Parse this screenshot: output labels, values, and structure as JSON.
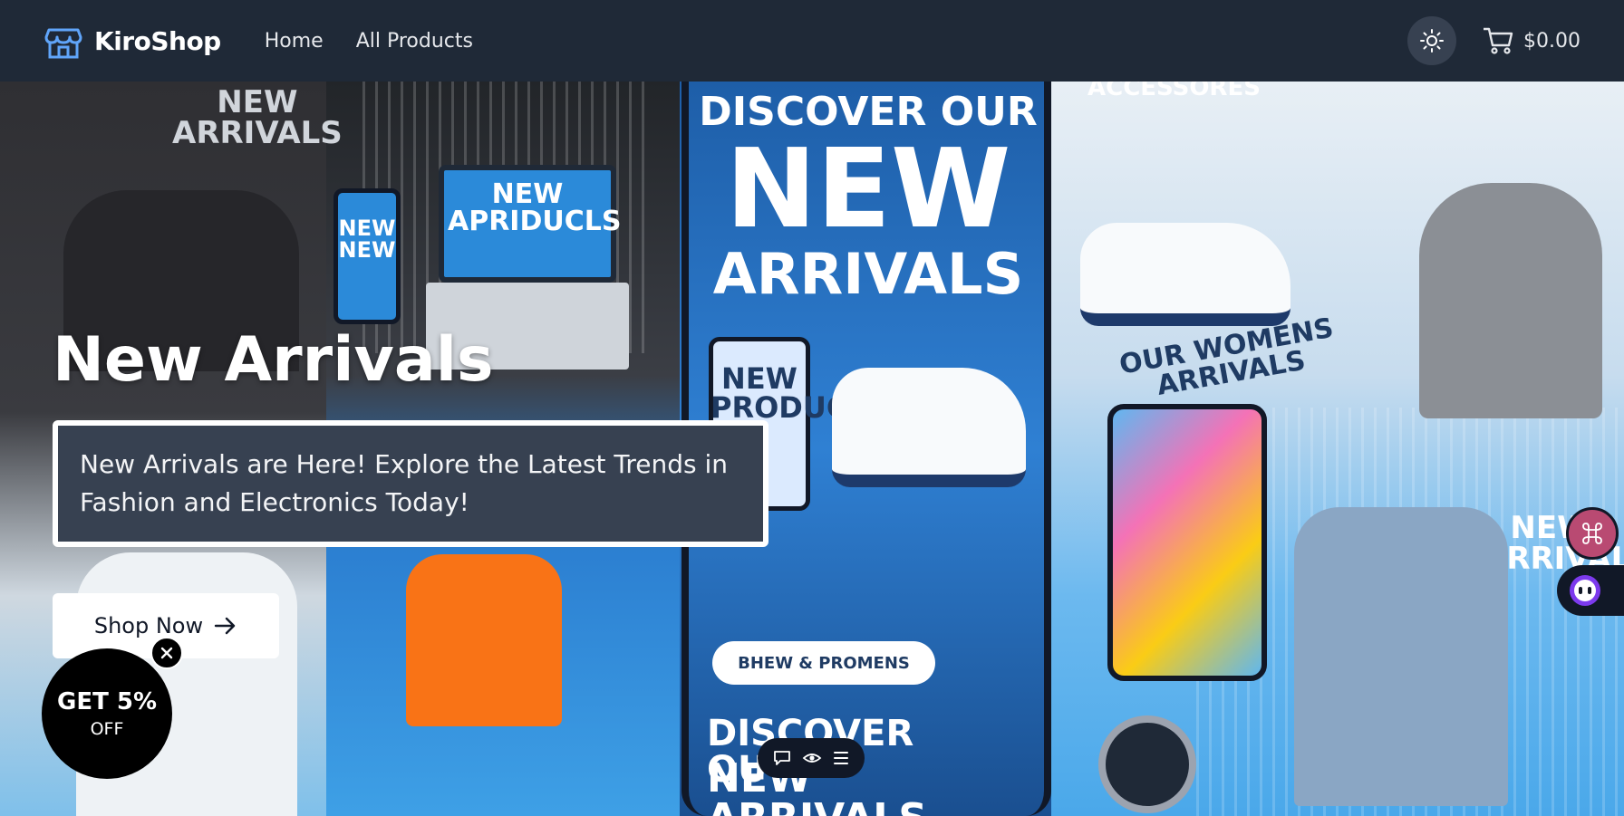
{
  "header": {
    "brand": "KiroShop",
    "nav": [
      "Home",
      "All Products"
    ],
    "cart_total": "$0.00"
  },
  "hero": {
    "title": "New Arrivals",
    "description": "New Arrivals are Here! Explore the Latest Trends in Fashion and Electronics Today!",
    "cta_label": "Shop Now",
    "art_text": {
      "new_arrivals_left": "NEW\nARRIVALS",
      "accessories": "ACCESSORES",
      "discover": "DISCOVER OUR",
      "new": "NEW",
      "arrivals": "ARRIVALS",
      "laptop_text": "NEW\nAPRIDUCLS",
      "phone_text": "NEW\nNEW",
      "womens": "OUR WOMENS\nARRIVALS",
      "new_products": "NEW\nPRODUCTS",
      "pill": "BHEW & PROMENS",
      "discover_bottom": "DISCOVER OU",
      "new_arrivals_bottom": "NEW ARRIVALS",
      "new_arrivals_right": "NEW\nARRIVALS"
    }
  },
  "discount": {
    "title": "GET 5%",
    "subtitle": "OFF"
  },
  "colors": {
    "navbar": "#1f2937",
    "desc_box": "#374151",
    "badge": "#000000"
  }
}
